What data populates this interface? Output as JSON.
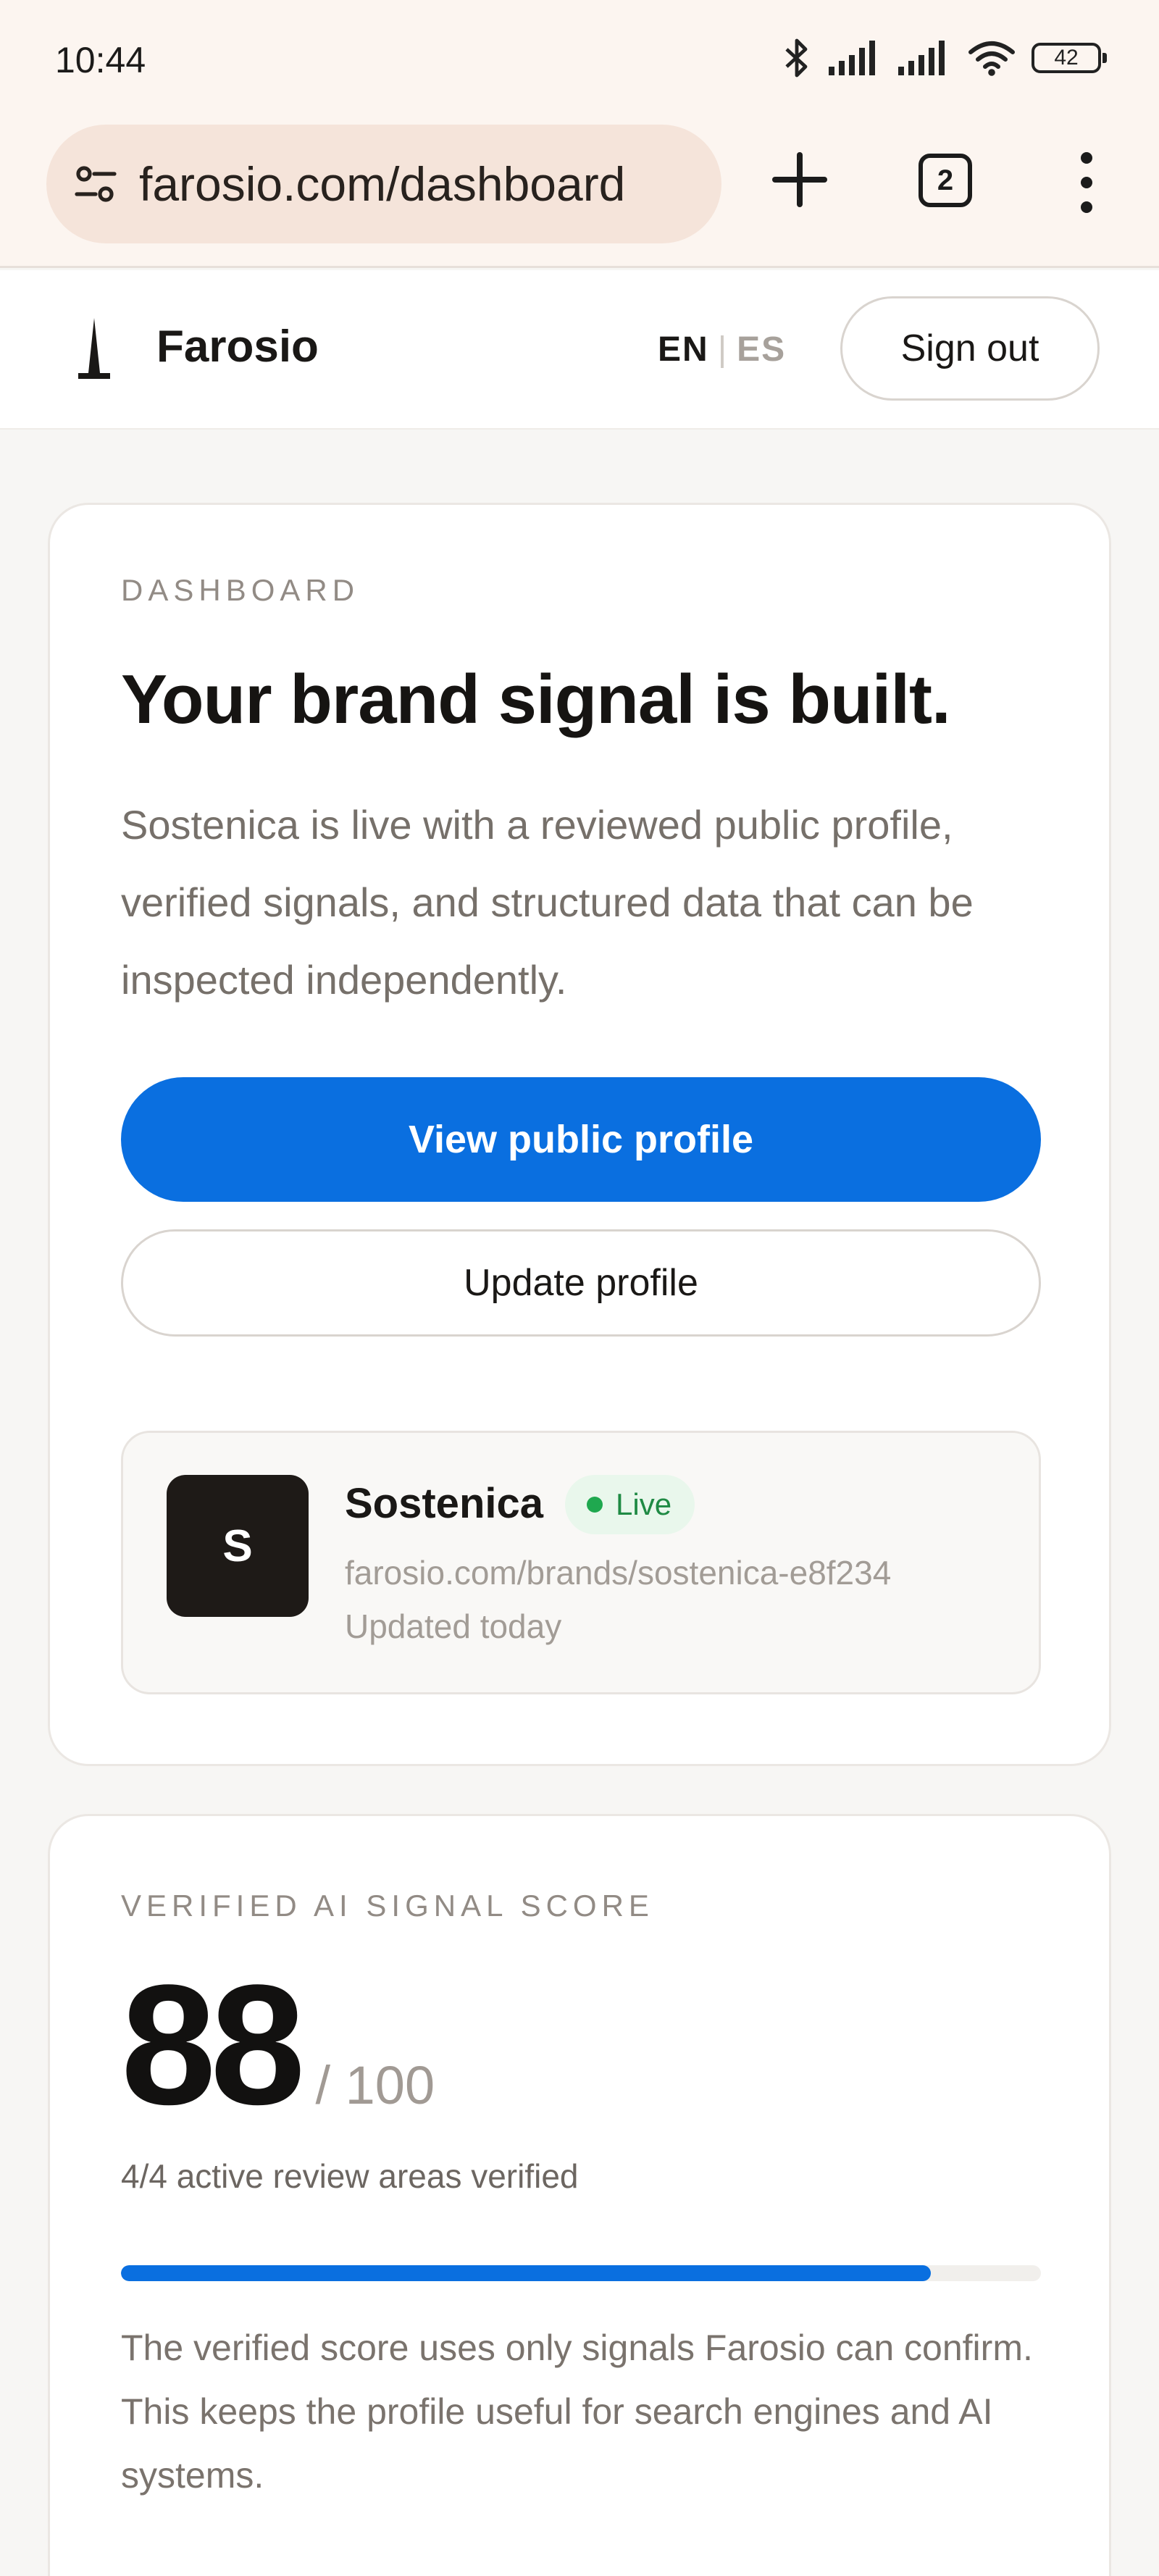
{
  "status_bar": {
    "time": "10:44",
    "battery_level": "42",
    "icons": [
      "bluetooth-icon",
      "signal-icon",
      "signal-icon",
      "wifi-icon",
      "battery-icon"
    ]
  },
  "browser": {
    "url": "farosio.com/dashboard",
    "tab_count": "2",
    "icons": [
      "site-settings-icon",
      "new-tab-icon",
      "tabs-icon",
      "more-menu-icon"
    ]
  },
  "header": {
    "brand": "Farosio",
    "lang_en": "EN",
    "lang_sep": "|",
    "lang_es": "ES",
    "sign_out": "Sign out"
  },
  "dashboard": {
    "eyebrow": "DASHBOARD",
    "headline": "Your brand signal is built.",
    "lead": "Sostenica is live with a reviewed public profile, verified signals, and structured data that can be inspected independently.",
    "primary_button": "View public profile",
    "secondary_button": "Update profile",
    "brand_card": {
      "initial": "S",
      "name": "Sostenica",
      "status": "Live",
      "url": "farosio.com/brands/sostenica-e8f234",
      "updated": "Updated today"
    }
  },
  "score_card": {
    "eyebrow": "VERIFIED AI SIGNAL SCORE",
    "score": "88",
    "score_max": "/ 100",
    "areas": "4/4 active review areas verified",
    "progress_fraction": 0.88,
    "description": "The verified score uses only signals Farosio can confirm. This keeps the profile useful for search engines and AI systems."
  },
  "colors": {
    "accent": "#0a6fe0",
    "live_green": "#1fa84f",
    "browser_chrome": "#fcf5f0"
  }
}
